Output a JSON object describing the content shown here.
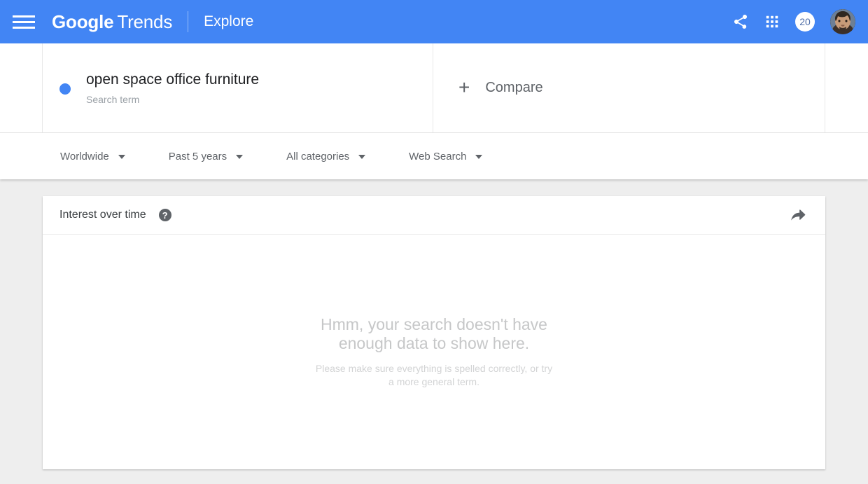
{
  "appbar": {
    "menu_icon": "hamburger-menu-icon",
    "brand_google": "Google",
    "brand_trends": "Trends",
    "section": "Explore",
    "share_icon": "share-icon",
    "apps_icon": "apps-grid-icon",
    "notification_count": "20",
    "avatar_icon": "user-avatar",
    "background_color": "#4285f4"
  },
  "terms": {
    "items": [
      {
        "dot_color": "#4285f4",
        "title": "open space office furniture",
        "subtitle": "Search term"
      }
    ],
    "compare": {
      "plus": "+",
      "label": "Compare"
    }
  },
  "filters": [
    {
      "label": "Worldwide",
      "name": "location-filter"
    },
    {
      "label": "Past 5 years",
      "name": "time-range-filter"
    },
    {
      "label": "All categories",
      "name": "category-filter"
    },
    {
      "label": "Web Search",
      "name": "search-type-filter"
    }
  ],
  "card": {
    "title": "Interest over time",
    "help_icon": "?",
    "share_icon": "share-arrow-icon",
    "empty_state": {
      "title": "Hmm, your search doesn't have enough data to show here.",
      "subtitle": "Please make sure everything is spelled correctly, or try a more general term."
    }
  },
  "colors": {
    "accent": "#4285f4",
    "page_background": "#eeeeee",
    "card_background": "#ffffff",
    "muted_text": "#5f6368"
  }
}
